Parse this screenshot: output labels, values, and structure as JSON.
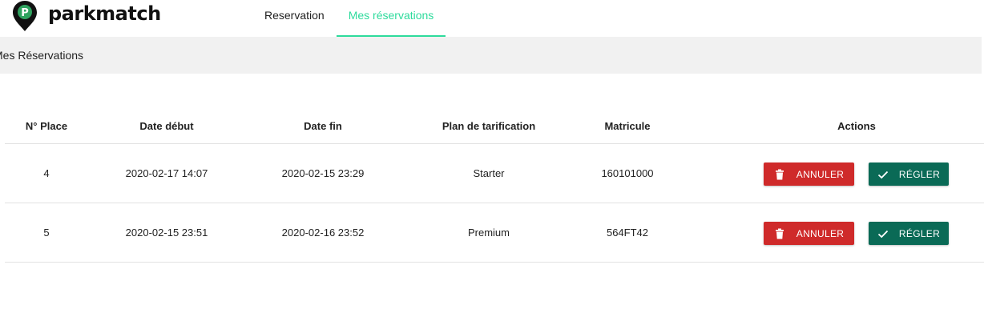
{
  "app": {
    "brand": "parkmatch"
  },
  "nav": {
    "tabs": [
      {
        "label": "Reservation",
        "active": false
      },
      {
        "label": "Mes réservations",
        "active": true
      }
    ]
  },
  "page": {
    "title": "Mes Réservations"
  },
  "table": {
    "headers": {
      "place": "N° Place",
      "date_debut": "Date début",
      "date_fin": "Date fin",
      "plan": "Plan de tarification",
      "matricule": "Matricule",
      "actions": "Actions"
    },
    "rows": [
      {
        "place": "4",
        "date_debut": "2020-02-17 14:07",
        "date_fin": "2020-02-15 23:29",
        "plan": "Starter",
        "matricule": "160101000"
      },
      {
        "place": "5",
        "date_debut": "2020-02-15 23:51",
        "date_fin": "2020-02-16 23:52",
        "plan": "Premium",
        "matricule": "564FT42"
      }
    ],
    "actions": {
      "cancel_label": "ANNULER",
      "pay_label": "RÉGLER",
      "cancel_icon": "trash-icon",
      "pay_icon": "check-icon"
    }
  },
  "colors": {
    "accent": "#2edb9c",
    "cancel": "#cf2a2a",
    "pay": "#0a6a56",
    "subbar": "#f1f1f1"
  }
}
